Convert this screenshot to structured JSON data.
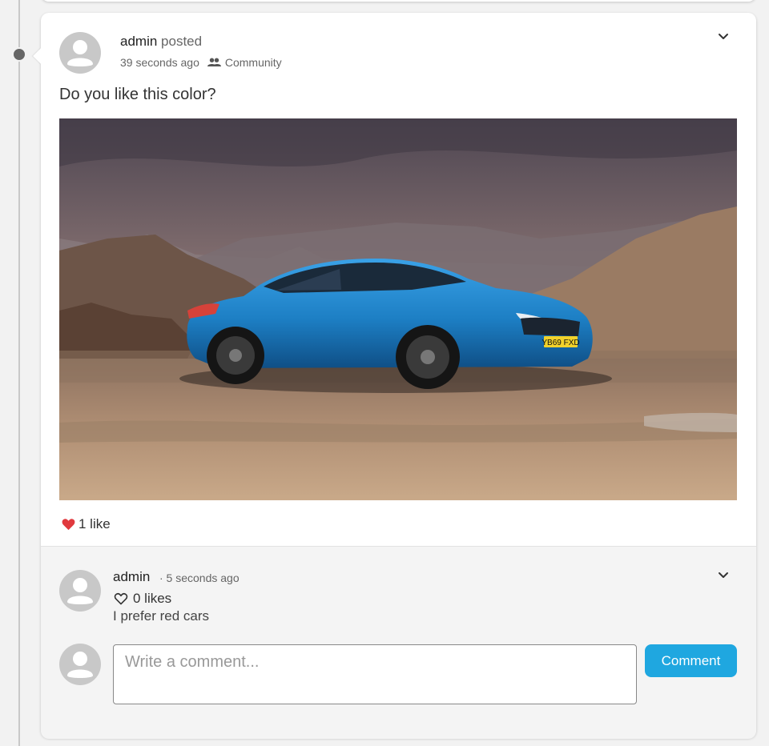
{
  "post": {
    "author": "admin",
    "action": "posted",
    "time": "39 seconds ago",
    "audience": "Community",
    "text": "Do you like this color?",
    "likes": "1 like",
    "image_plate": "YB69 FXD"
  },
  "comment": {
    "author": "admin",
    "time": "· 5 seconds ago",
    "likes": "0 likes",
    "text": "I prefer red cars"
  },
  "composer": {
    "placeholder": "Write a comment...",
    "button_label": "Comment"
  },
  "colors": {
    "accent": "#1fa7e0",
    "heart": "#e0393e",
    "car": "#1d7fc4"
  }
}
